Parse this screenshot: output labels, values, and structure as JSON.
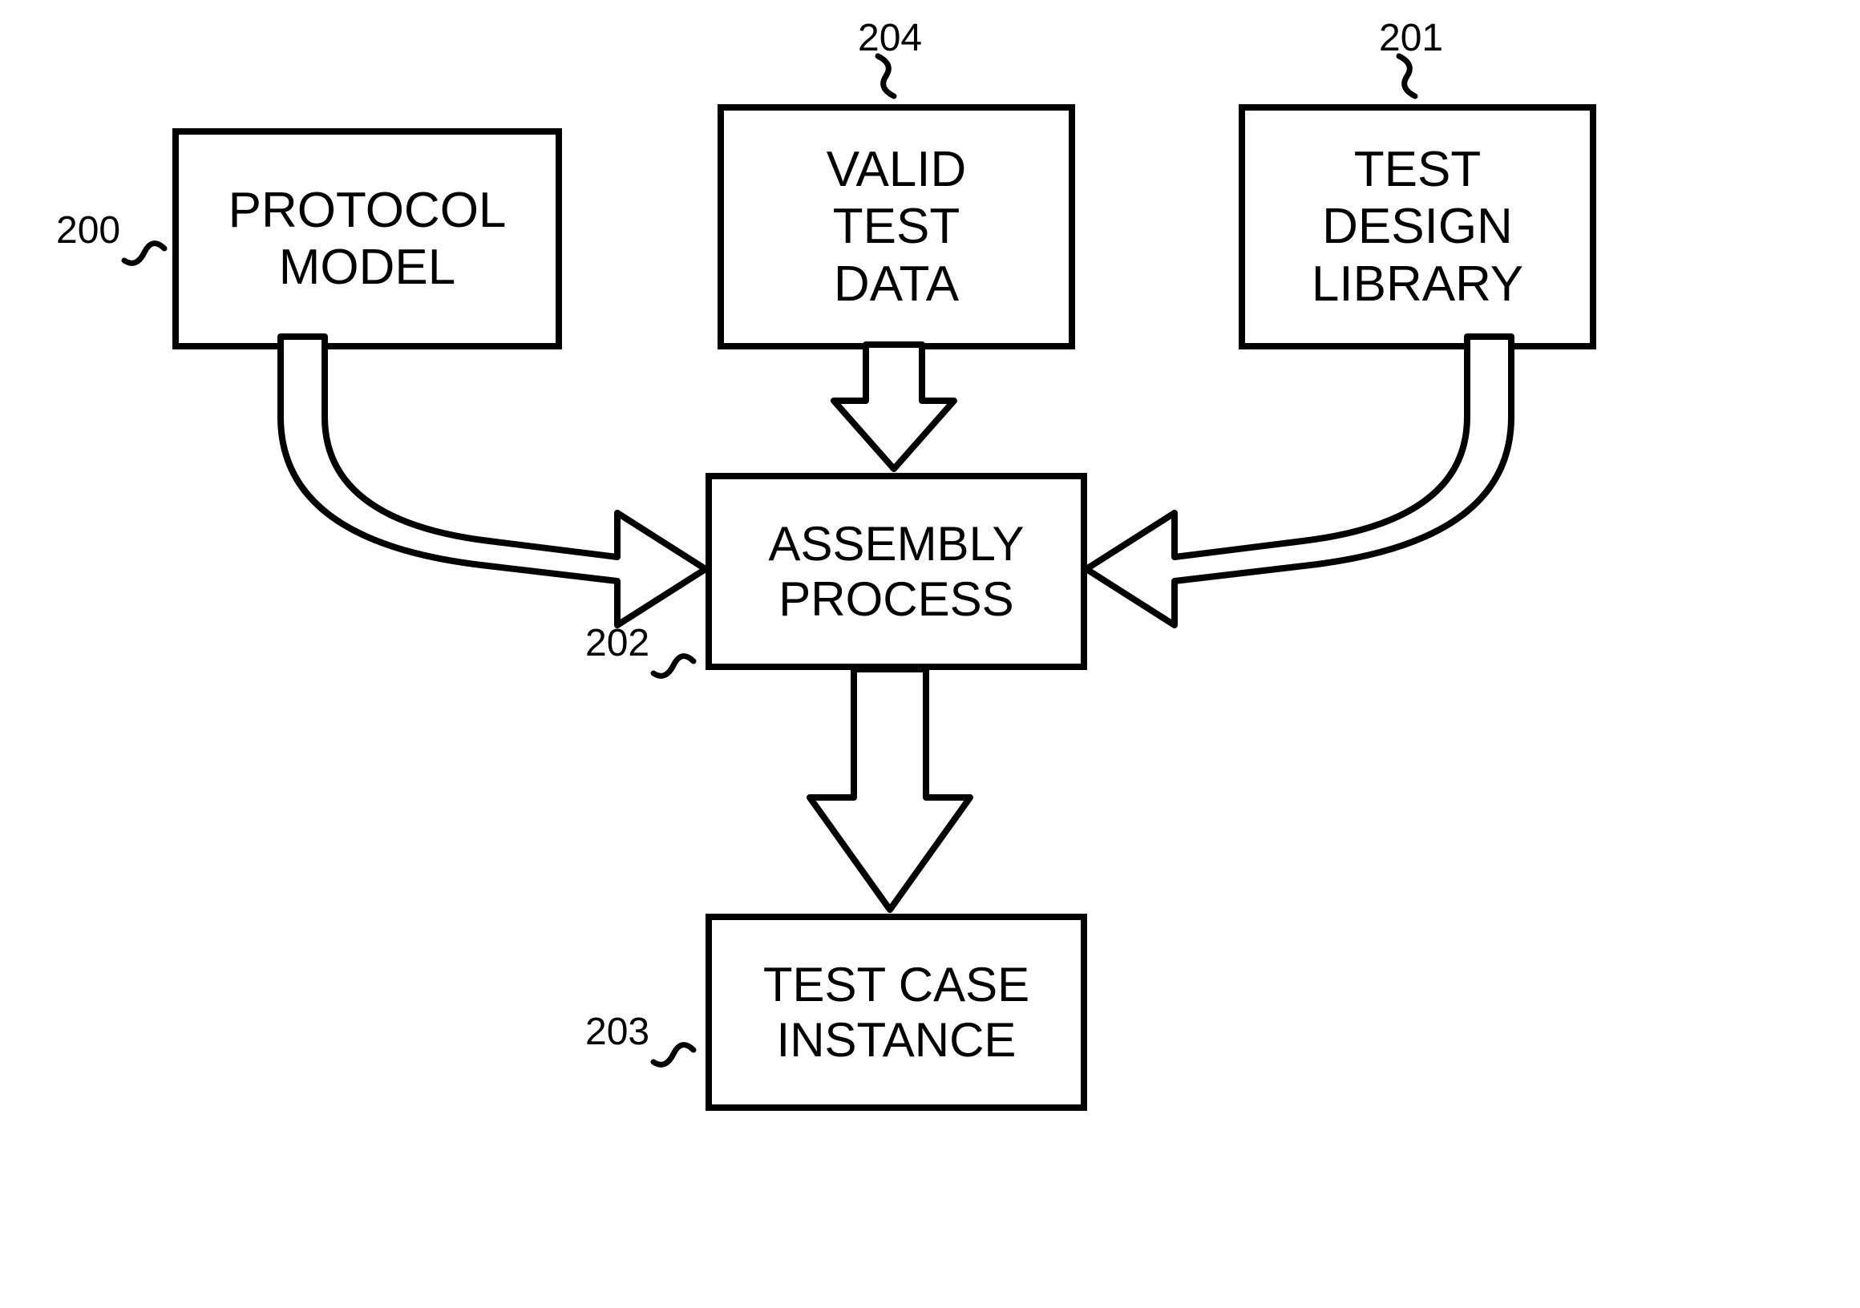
{
  "boxes": {
    "protocol_model": {
      "label": "PROTOCOL\nMODEL",
      "ref": "200"
    },
    "valid_test_data": {
      "label": "VALID\nTEST\nDATA",
      "ref": "204"
    },
    "test_design_library": {
      "label": "TEST\nDESIGN\nLIBRARY",
      "ref": "201"
    },
    "assembly_process": {
      "label": "ASSEMBLY\nPROCESS",
      "ref": "202"
    },
    "test_case_instance": {
      "label": "TEST CASE\nINSTANCE",
      "ref": "203"
    }
  }
}
